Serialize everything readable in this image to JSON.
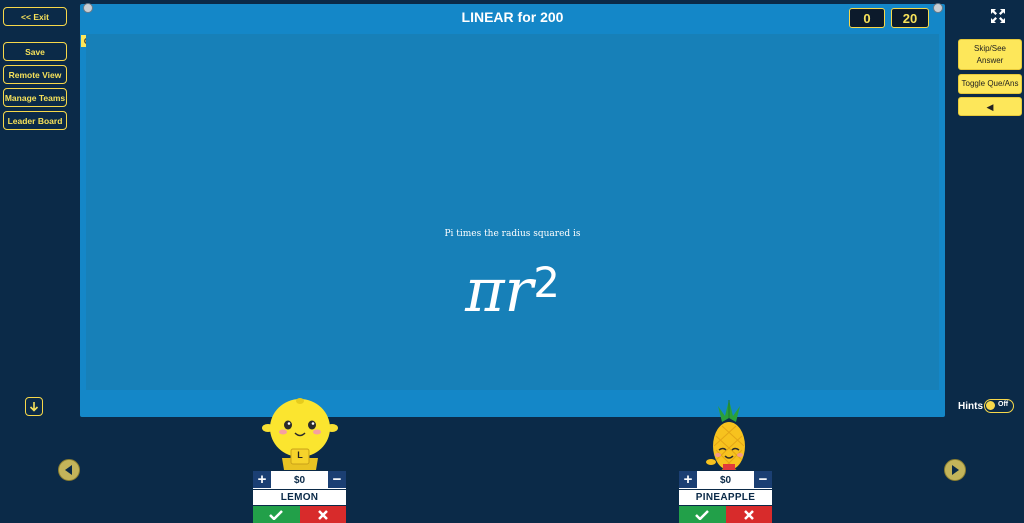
{
  "left_menu": {
    "exit": "<< Exit",
    "save": "Save",
    "remote_view": "Remote View",
    "manage_teams": "Manage Teams",
    "leader_board": "Leader Board"
  },
  "board": {
    "title": "LINEAR for 200",
    "q_tag": "Q",
    "score_left": "0",
    "score_right": "20",
    "question_text": "Pi times the radius squared is",
    "formula_base": "πr",
    "formula_exp": "2"
  },
  "right_menu": {
    "skip": "Skip/See Answer",
    "toggle": "Toggle Que/Ans",
    "sound": "◀"
  },
  "hints": {
    "label": "Hints",
    "toggle": "Off"
  },
  "teams": [
    {
      "money": "$0",
      "name": "LEMON",
      "badge": "L"
    },
    {
      "money": "$0",
      "name": "PINEAPPLE"
    }
  ],
  "colors": {
    "accent": "#f7d84a",
    "board": "#1487c8",
    "background": "#0b2a48",
    "correct": "#22a049",
    "wrong": "#d82b2b"
  }
}
